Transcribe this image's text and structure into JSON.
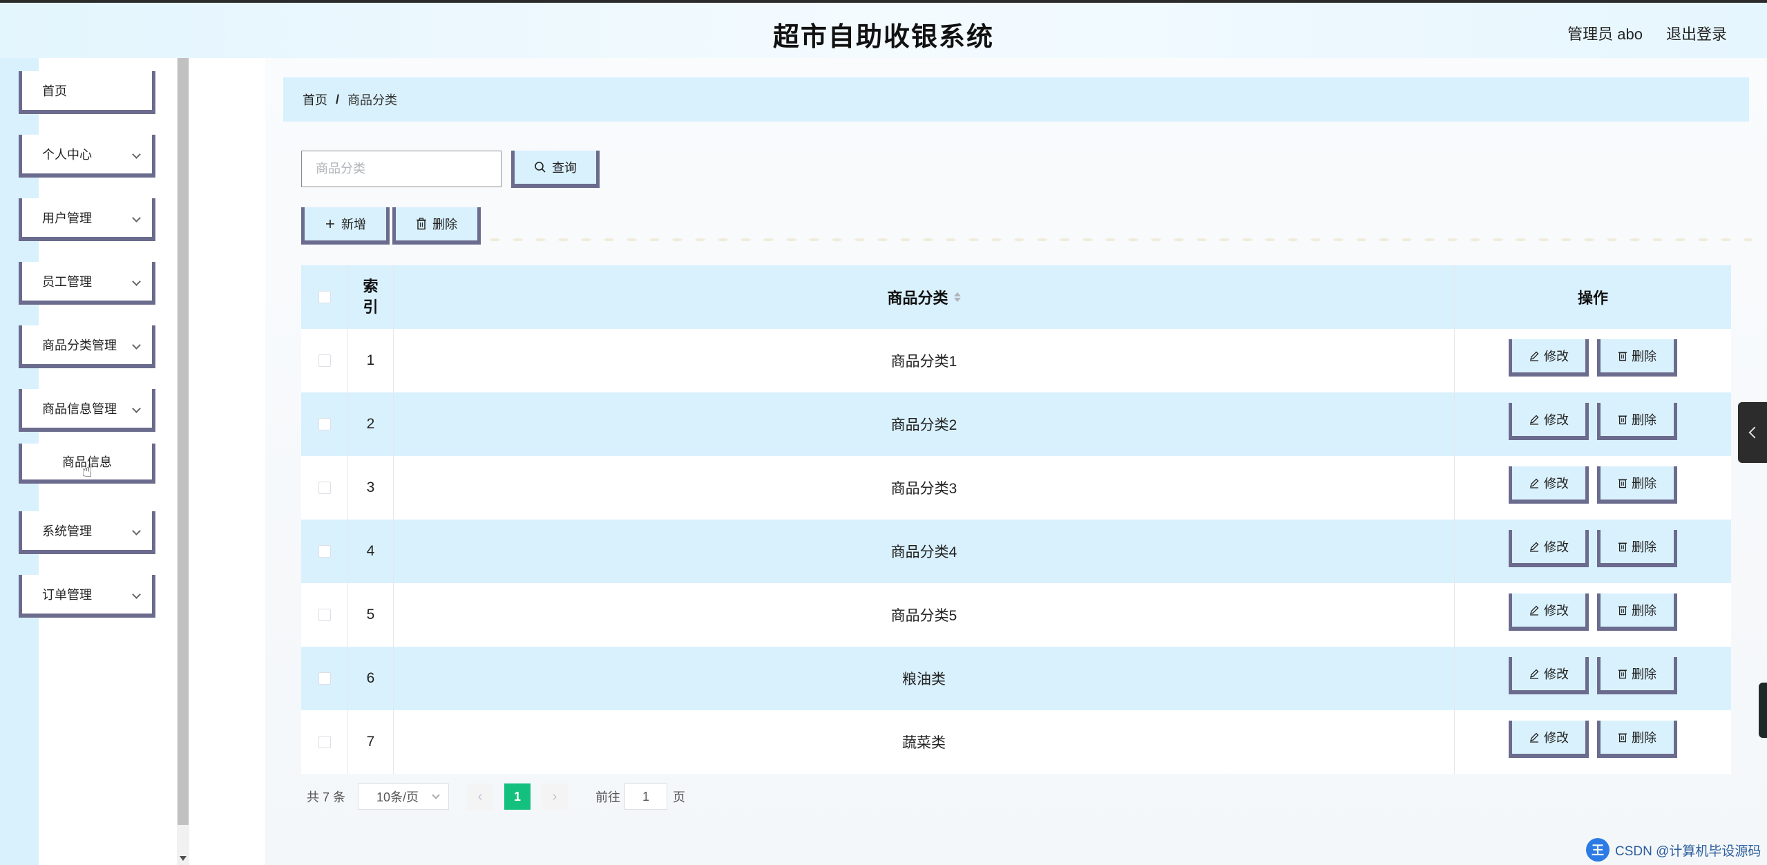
{
  "header": {
    "title": "超市自助收银系统",
    "user": "管理员 abo",
    "logout": "退出登录"
  },
  "sidebar": {
    "items": [
      {
        "label": "首页",
        "has_children": false
      },
      {
        "label": "个人中心",
        "has_children": true
      },
      {
        "label": "用户管理",
        "has_children": true
      },
      {
        "label": "员工管理",
        "has_children": true
      },
      {
        "label": "商品分类管理",
        "has_children": true
      },
      {
        "label": "商品信息管理",
        "has_children": true
      },
      {
        "label": "商品信息",
        "has_children": false,
        "submenu": true
      },
      {
        "label": "系统管理",
        "has_children": true
      },
      {
        "label": "订单管理",
        "has_children": true
      }
    ]
  },
  "breadcrumb": {
    "home": "首页",
    "separator": "/",
    "current": "商品分类"
  },
  "search": {
    "placeholder": "商品分类",
    "value": "",
    "button": "查询"
  },
  "toolbar": {
    "add": "新增",
    "delete": "删除"
  },
  "table": {
    "headers": {
      "index": "索引",
      "name": "商品分类",
      "ops": "操作"
    },
    "rows": [
      {
        "index": "1",
        "name": "商品分类1"
      },
      {
        "index": "2",
        "name": "商品分类2"
      },
      {
        "index": "3",
        "name": "商品分类3"
      },
      {
        "index": "4",
        "name": "商品分类4"
      },
      {
        "index": "5",
        "name": "商品分类5"
      },
      {
        "index": "6",
        "name": "粮油类"
      },
      {
        "index": "7",
        "name": "蔬菜类"
      }
    ],
    "edit_label": "修改",
    "delete_label": "删除"
  },
  "pagination": {
    "total": "共 7 条",
    "page_size": "10条/页",
    "current_page": "1",
    "goto_prefix": "前往",
    "goto_value": "1",
    "goto_suffix": "页"
  },
  "watermark": {
    "badge": "王",
    "text": "CSDN @计算机毕设源码"
  },
  "colors": {
    "accent_light": "#d9f1fd",
    "border_purple": "#6b6b8e",
    "page_active": "#13c07d"
  },
  "icons": {
    "search": "search-icon",
    "add": "plus-icon",
    "delete": "trash-icon",
    "edit": "pencil-icon",
    "sort": "sort-icon",
    "expand": "chevron-down-icon",
    "prev": "chevron-left-icon",
    "next": "chevron-right-icon"
  }
}
